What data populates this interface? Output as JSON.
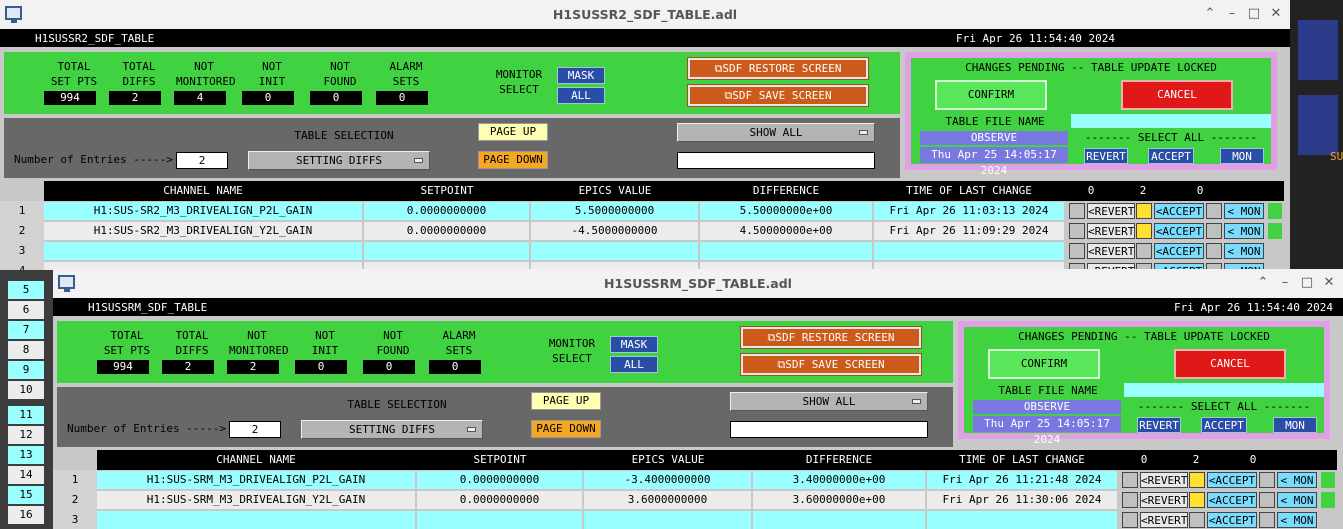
{
  "bg_right_label": "SU",
  "rownums_left": [
    "1",
    "2",
    "3",
    "4",
    "5",
    "6",
    "7",
    "8",
    "9",
    "10",
    "11",
    "12",
    "13",
    "14",
    "15",
    "16"
  ],
  "windows": [
    {
      "title": "H1SUSSR2_SDF_TABLE.adl",
      "header_name": "H1SUSSR2_SDF_TABLE",
      "header_date": "Fri Apr 26 11:54:40 2024",
      "stats": [
        {
          "l1": "TOTAL",
          "l2": "SET PTS",
          "v": "994"
        },
        {
          "l1": "TOTAL",
          "l2": "DIFFS",
          "v": "2"
        },
        {
          "l1": "NOT",
          "l2": "MONITORED",
          "v": "4"
        },
        {
          "l1": "NOT",
          "l2": "INIT",
          "v": "0"
        },
        {
          "l1": "NOT",
          "l2": "FOUND",
          "v": "0"
        },
        {
          "l1": "ALARM",
          "l2": "SETS",
          "v": "0"
        }
      ],
      "monitor_l1": "MONITOR",
      "monitor_l2": "SELECT",
      "mask": "MASK",
      "all": "ALL",
      "restore": "⧉SDF RESTORE SCREEN",
      "save": "⧉SDF SAVE SCREEN",
      "table_selection": "TABLE SELECTION",
      "entries_label": "Number of Entries ----->",
      "entries": "2",
      "setting_diffs": "SETTING DIFFS",
      "page_up": "PAGE UP",
      "page_down": "PAGE DOWN",
      "show_all": "SHOW ALL",
      "pending": "CHANGES PENDING -- TABLE UPDATE LOCKED",
      "confirm": "CONFIRM",
      "cancel": "CANCEL",
      "table_file": "TABLE FILE NAME",
      "observe": "OBSERVE",
      "file_date": "Thu Apr 25 14:05:17 2024",
      "select_all": "------- SELECT ALL -------",
      "revert": "REVERT",
      "accept": "ACCEPT",
      "mon": "MON",
      "cols": [
        "CHANNEL NAME",
        "SETPOINT",
        "EPICS VALUE",
        "DIFFERENCE",
        "TIME OF LAST CHANGE",
        "0",
        "2",
        "0"
      ],
      "rows": [
        {
          "n": "1",
          "ch": "H1:SUS-SR2_M3_DRIVEALIGN_P2L_GAIN",
          "sp": "0.0000000000",
          "ev": "5.5000000000",
          "df": "5.50000000e+00",
          "t": "Fri Apr 26 11:03:13 2024"
        },
        {
          "n": "2",
          "ch": "H1:SUS-SR2_M3_DRIVEALIGN_Y2L_GAIN",
          "sp": "0.0000000000",
          "ev": "-4.5000000000",
          "df": "4.50000000e+00",
          "t": "Fri Apr 26 11:09:29 2024"
        },
        {
          "n": "3",
          "ch": "",
          "sp": "",
          "ev": "",
          "df": "",
          "t": ""
        },
        {
          "n": "4",
          "ch": "",
          "sp": "",
          "ev": "",
          "df": "",
          "t": ""
        }
      ],
      "row_revert": "<REVERT",
      "row_accept": "<ACCEPT",
      "row_mon": "< MON"
    },
    {
      "title": "H1SUSSRM_SDF_TABLE.adl",
      "header_name": "H1SUSSRM_SDF_TABLE",
      "header_date": "Fri Apr 26 11:54:40 2024",
      "stats": [
        {
          "l1": "TOTAL",
          "l2": "SET PTS",
          "v": "994"
        },
        {
          "l1": "TOTAL",
          "l2": "DIFFS",
          "v": "2"
        },
        {
          "l1": "NOT",
          "l2": "MONITORED",
          "v": "2"
        },
        {
          "l1": "NOT",
          "l2": "INIT",
          "v": "0"
        },
        {
          "l1": "NOT",
          "l2": "FOUND",
          "v": "0"
        },
        {
          "l1": "ALARM",
          "l2": "SETS",
          "v": "0"
        }
      ],
      "monitor_l1": "MONITOR",
      "monitor_l2": "SELECT",
      "mask": "MASK",
      "all": "ALL",
      "restore": "⧉SDF RESTORE SCREEN",
      "save": "⧉SDF SAVE SCREEN",
      "table_selection": "TABLE SELECTION",
      "entries_label": "Number of Entries ----->",
      "entries": "2",
      "setting_diffs": "SETTING DIFFS",
      "page_up": "PAGE UP",
      "page_down": "PAGE DOWN",
      "show_all": "SHOW ALL",
      "pending": "CHANGES PENDING -- TABLE UPDATE LOCKED",
      "confirm": "CONFIRM",
      "cancel": "CANCEL",
      "table_file": "TABLE FILE NAME",
      "observe": "OBSERVE",
      "file_date": "Thu Apr 25 14:05:17 2024",
      "select_all": "------- SELECT ALL -------",
      "revert": "REVERT",
      "accept": "ACCEPT",
      "mon": "MON",
      "cols": [
        "CHANNEL NAME",
        "SETPOINT",
        "EPICS VALUE",
        "DIFFERENCE",
        "TIME OF LAST CHANGE",
        "0",
        "2",
        "0"
      ],
      "rows": [
        {
          "n": "1",
          "ch": "H1:SUS-SRM_M3_DRIVEALIGN_P2L_GAIN",
          "sp": "0.0000000000",
          "ev": "-3.4000000000",
          "df": "3.40000000e+00",
          "t": "Fri Apr 26 11:21:48 2024"
        },
        {
          "n": "2",
          "ch": "H1:SUS-SRM_M3_DRIVEALIGN_Y2L_GAIN",
          "sp": "0.0000000000",
          "ev": "3.6000000000",
          "df": "3.60000000e+00",
          "t": "Fri Apr 26 11:30:06 2024"
        },
        {
          "n": "3",
          "ch": "",
          "sp": "",
          "ev": "",
          "df": "",
          "t": ""
        }
      ],
      "row_revert": "<REVERT",
      "row_accept": "<ACCEPT",
      "row_mon": "< MON"
    }
  ]
}
